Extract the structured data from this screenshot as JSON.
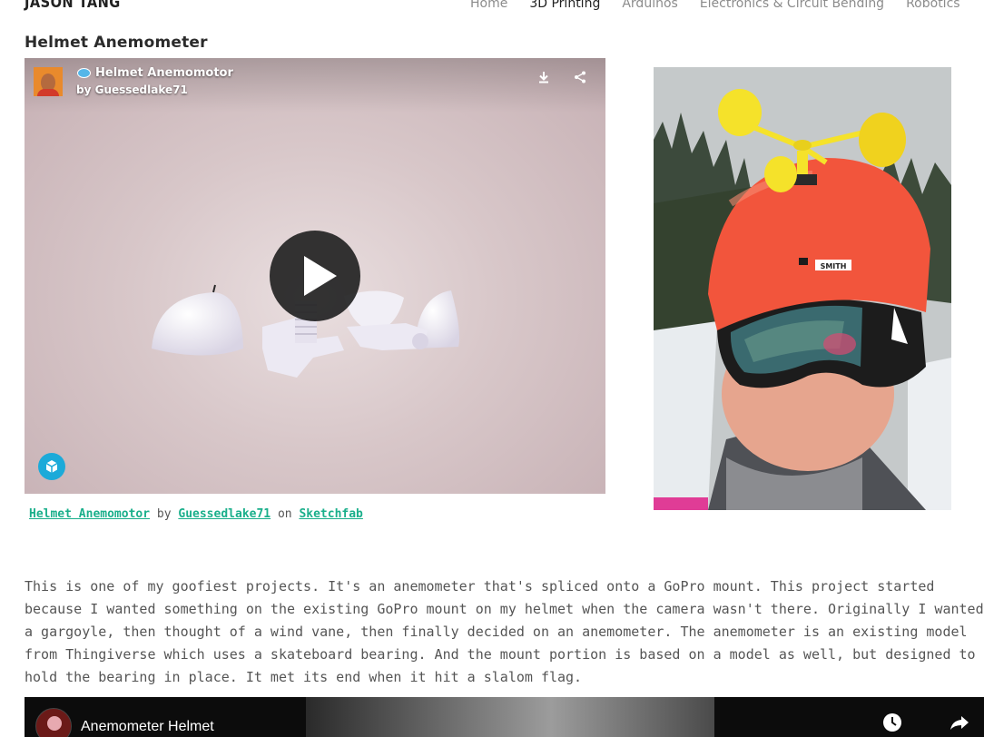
{
  "site": {
    "logo": "JASON TANG"
  },
  "nav": {
    "items": [
      {
        "label": "Home"
      },
      {
        "label": "3D Printing"
      },
      {
        "label": "Arduinos"
      },
      {
        "label": "Electronics & Circuit Bending"
      },
      {
        "label": "Robotics"
      }
    ],
    "active_index": 1
  },
  "page": {
    "title": "Helmet Anemometer"
  },
  "sketchfab": {
    "model_title": "Helmet Anemomotor",
    "author_line": "by Guessedlake71",
    "credit": {
      "model_link": "Helmet Anemomotor",
      "by": "by",
      "author_link": "Guessedlake71",
      "on": "on",
      "site_link": "Sketchfab"
    }
  },
  "article": {
    "paragraph": "This is one of my goofiest projects. It's an anemometer that's spliced onto a GoPro mount. This project started because I wanted something on the existing GoPro mount on my helmet when the camera wasn't there. Originally I wanted a gargoyle, then thought of a wind vane, then finally decided on an anemometer. The anemometer is an existing model from Thingiverse which uses a skateboard bearing. And the mount portion is based on a model as well, but designed to hold the bearing in place. It met its end when it hit a slalom flag."
  },
  "youtube": {
    "title": "Anemometer Helmet"
  },
  "colors": {
    "link": "#1aaf8b",
    "nav_active": "#222222",
    "nav_inactive": "#8c8c8c",
    "helmet": "#f2553c",
    "anemometer": "#f5e22a"
  }
}
